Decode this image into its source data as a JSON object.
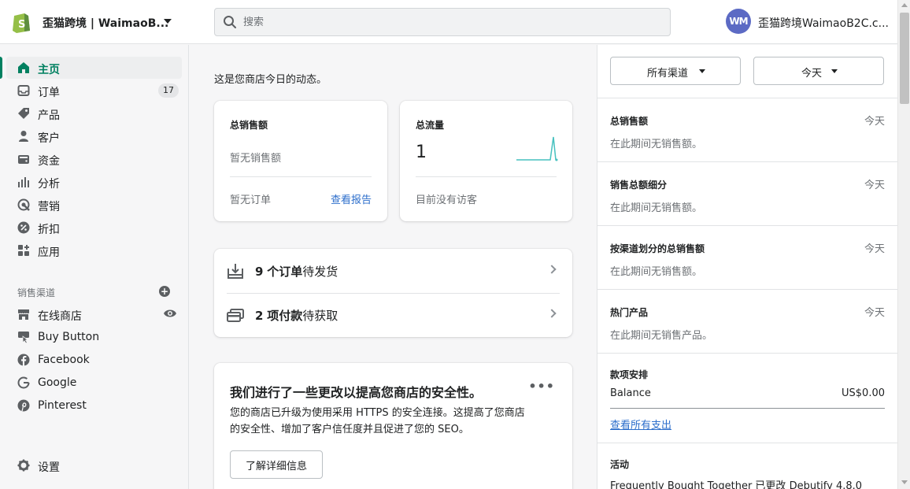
{
  "topbar": {
    "store_name": "歪猫跨境 | WaimaoB...",
    "search_placeholder": "搜索",
    "avatar_initials": "WM",
    "user_name": "歪猫跨境WaimaoB2C.c..."
  },
  "colors": {
    "brand": "#008060",
    "link": "#2c6ecb",
    "avatar": "#5c6ac4",
    "chart_line": "#47c1bf"
  },
  "sidebar": {
    "items": [
      {
        "label": "主页",
        "icon": "home-icon",
        "active": true
      },
      {
        "label": "订单",
        "icon": "orders-icon",
        "badge": "17"
      },
      {
        "label": "产品",
        "icon": "tag-icon"
      },
      {
        "label": "客户",
        "icon": "person-icon"
      },
      {
        "label": "资金",
        "icon": "wallet-icon"
      },
      {
        "label": "分析",
        "icon": "bar-chart-icon"
      },
      {
        "label": "营销",
        "icon": "target-icon"
      },
      {
        "label": "折扣",
        "icon": "discount-icon"
      },
      {
        "label": "应用",
        "icon": "apps-icon"
      }
    ],
    "channels_label": "销售渠道",
    "channels": [
      {
        "label": "在线商店",
        "icon": "store-icon"
      },
      {
        "label": "Buy Button",
        "icon": "buy-button-icon"
      },
      {
        "label": "Facebook",
        "icon": "facebook-icon"
      },
      {
        "label": "Google",
        "icon": "google-icon"
      },
      {
        "label": "Pinterest",
        "icon": "pinterest-icon"
      }
    ],
    "settings_label": "设置"
  },
  "main": {
    "intro": "这是您商店今日的动态。",
    "sales_card": {
      "title": "总销售额",
      "empty": "暂无销售额",
      "orders_empty": "暂无订单",
      "report_link": "查看报告"
    },
    "traffic_card": {
      "title": "总流量",
      "value": "1",
      "footer": "目前没有访客"
    },
    "tasks": [
      {
        "count": "9",
        "bold": "个订单",
        "rest": "待发货",
        "icon": "download-box-icon"
      },
      {
        "count": "2",
        "bold": "项付款",
        "rest": "待获取",
        "icon": "credit-card-icon"
      }
    ],
    "security_card": {
      "title": "我们进行了一些更改以提高您商店的安全性。",
      "body": "您的商店已升级为使用采用 HTTPS 的安全连接。这提高了您商店的安全性、增加了客户信任度并且促进了您的 SEO。",
      "button": "了解详细信息",
      "more": "•••"
    }
  },
  "right": {
    "channel_filter": "所有渠道",
    "date_filter": "今天",
    "sections": [
      {
        "title": "总销售额",
        "period": "今天",
        "text": "在此期间无销售额。"
      },
      {
        "title": "销售总额细分",
        "period": "今天",
        "text": "在此期间无销售额。"
      },
      {
        "title": "按渠道划分的总销售额",
        "period": "今天",
        "text": "在此期间无销售额。"
      },
      {
        "title": "热门产品",
        "period": "今天",
        "text": "在此期间无销售产品。"
      }
    ],
    "payouts": {
      "title": "款项安排",
      "balance_label": "Balance",
      "balance_value": "US$0.00",
      "link": "查看所有支出"
    },
    "activity": {
      "title": "活动",
      "text": "Frequently Bought Together 已更改 Debutify 4.8.0"
    }
  }
}
